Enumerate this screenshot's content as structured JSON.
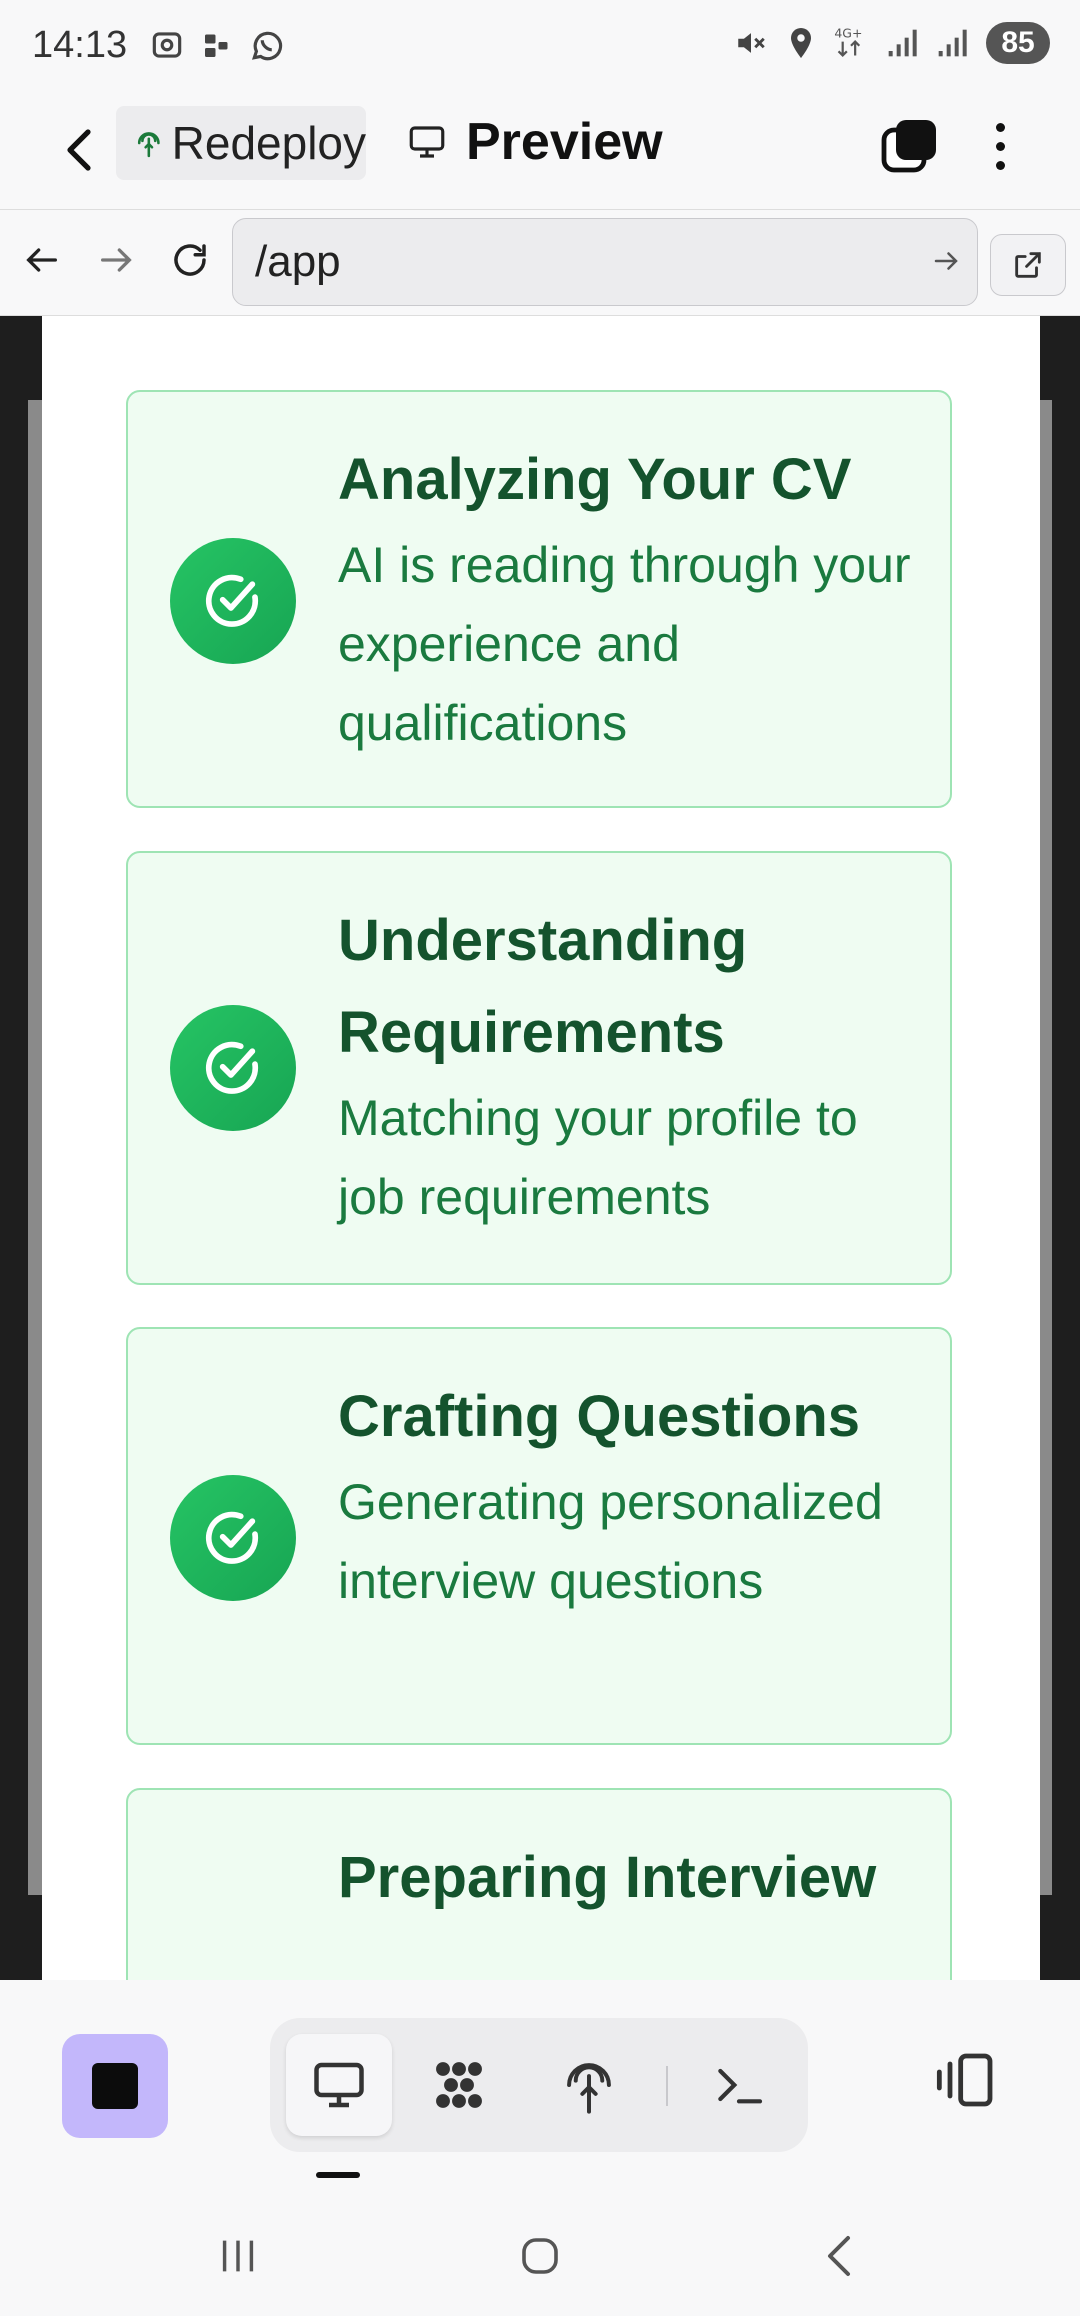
{
  "status_bar": {
    "time": "14:13",
    "battery": "85"
  },
  "header": {
    "project_chip": "Redeploy",
    "title": "Preview"
  },
  "url_bar": {
    "url": "/app"
  },
  "cards": [
    {
      "title": "Analyzing Your CV",
      "description": "AI is reading through your experience and qualifications",
      "status": "completed"
    },
    {
      "title": "Understanding Requirements",
      "description": "Matching your profile to job requirements",
      "status": "completed"
    },
    {
      "title": "Crafting Questions",
      "description": "Generating personalized interview questions",
      "status": "completed"
    },
    {
      "title": "Preparing Interview",
      "description": "",
      "status": "pending"
    }
  ],
  "colors": {
    "card_bg": "#effcf2",
    "card_border": "#9ee4b4",
    "title_green": "#14532d",
    "desc_green": "#1a7a3f",
    "icon_green": "#22c55e",
    "stop_button": "#c3b7fb"
  },
  "icons": {
    "status": [
      "screen-record-icon",
      "dots-icon",
      "whatsapp-icon",
      "mute-icon",
      "location-icon",
      "network-4g-icon",
      "signal-icon",
      "signal-icon"
    ],
    "toolbar": [
      "stop-icon",
      "monitor-icon",
      "grid-app-icon",
      "deploy-icon",
      "terminal-icon",
      "devices-icon"
    ],
    "card": "check-circle-icon"
  }
}
